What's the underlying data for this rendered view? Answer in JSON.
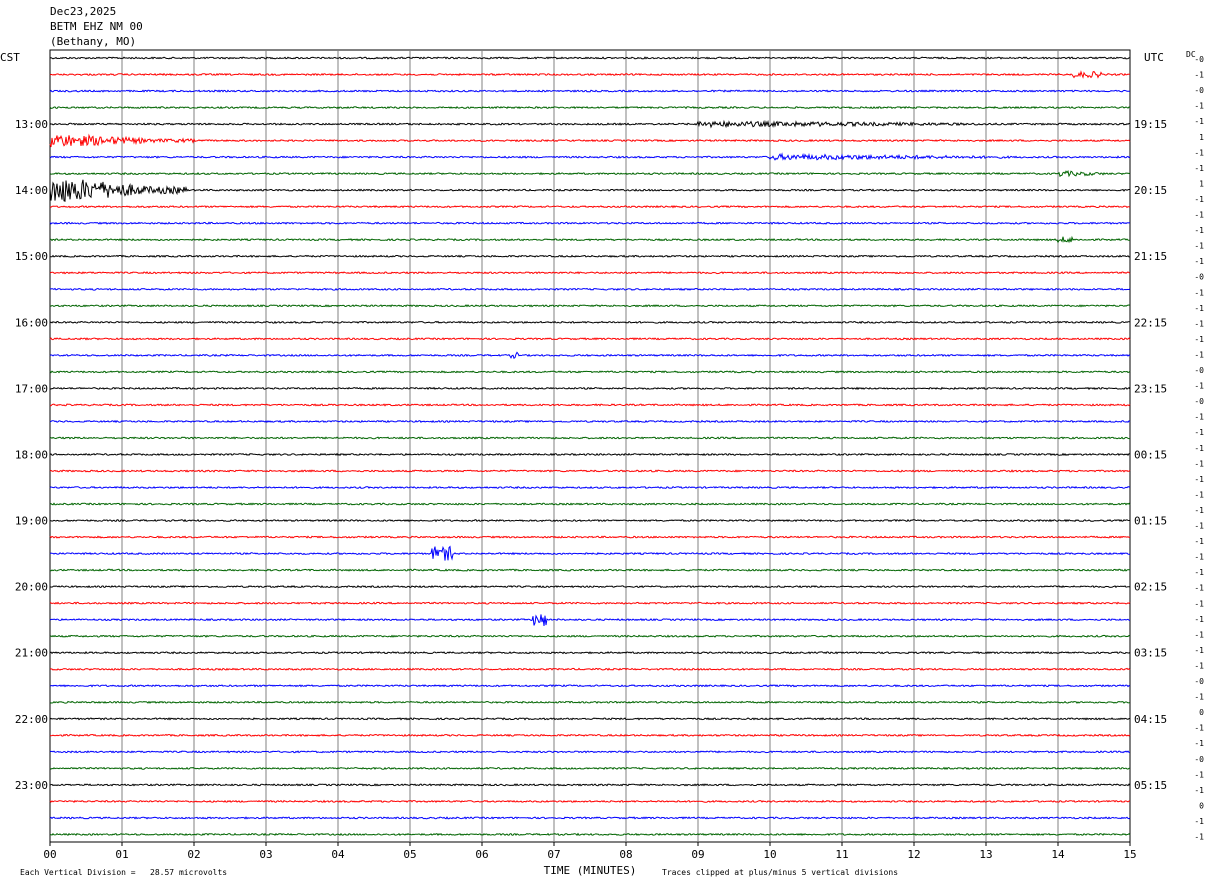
{
  "header": {
    "date": "Dec23,2025",
    "station": "BETM EHZ NM 00",
    "location": "(Bethany, MO)"
  },
  "footer": {
    "division_note": "Each Vertical Division =   28.57 microvolts",
    "clip_note": "Traces clipped at plus/minus 5 vertical divisions"
  },
  "chart_data": {
    "type": "seismogram",
    "left_axis_label": "CST",
    "right_axis_label": "UTC",
    "dc_label": "DC",
    "xlabel": "TIME (MINUTES)",
    "x_ticks": [
      "00",
      "01",
      "02",
      "03",
      "04",
      "05",
      "06",
      "07",
      "08",
      "09",
      "10",
      "11",
      "12",
      "13",
      "14",
      "15"
    ],
    "x_range_minutes": [
      0,
      15
    ],
    "trace_colors": [
      "#000000",
      "#ff0000",
      "#0000ff",
      "#006400"
    ],
    "trace_count": 48,
    "cst_labels": [
      "13:00",
      "14:00",
      "15:00",
      "16:00",
      "17:00",
      "18:00",
      "19:00",
      "20:00",
      "21:00",
      "22:00",
      "23:00"
    ],
    "utc_labels": [
      "19:15",
      "20:15",
      "21:15",
      "22:15",
      "23:15",
      "00:15",
      "01:15",
      "02:15",
      "03:15",
      "04:15",
      "05:15"
    ],
    "dc_offsets": [
      "-0",
      "-1",
      "-0",
      "-1",
      "-1",
      "1",
      "-1",
      "-1",
      "1",
      "-1",
      "-1",
      "-1",
      "-1",
      "-1",
      "-0",
      "-1",
      "-1",
      "-1",
      "-1",
      "-1",
      "-0",
      "-1",
      "-0",
      "-1",
      "-1",
      "-1",
      "-1",
      "-1",
      "-1",
      "-1",
      "-1",
      "-1",
      "-1",
      "-1",
      "-1",
      "-1",
      "-1",
      "-1",
      "-1",
      "-1",
      "-0",
      "-1",
      "0",
      "-1",
      "-1",
      "-0",
      "-1",
      "-1",
      "0",
      "-1",
      "-1"
    ],
    "events": [
      {
        "trace": 8,
        "start_min": 0.0,
        "end_min": 1.9,
        "amplitude": "large"
      },
      {
        "trace": 5,
        "start_min": 0.0,
        "end_min": 2.0,
        "amplitude": "medium"
      },
      {
        "trace": 4,
        "start_min": 9.0,
        "end_min": 15.0,
        "amplitude": "small"
      },
      {
        "trace": 6,
        "start_min": 10.0,
        "end_min": 15.0,
        "amplitude": "small"
      },
      {
        "trace": 7,
        "start_min": 14.0,
        "end_min": 15.0,
        "amplitude": "small"
      },
      {
        "trace": 1,
        "start_min": 14.2,
        "end_min": 14.6,
        "amplitude": "small"
      },
      {
        "trace": 30,
        "start_min": 5.3,
        "end_min": 5.6,
        "amplitude": "medium"
      },
      {
        "trace": 34,
        "start_min": 6.7,
        "end_min": 6.9,
        "amplitude": "medium"
      },
      {
        "trace": 18,
        "start_min": 6.4,
        "end_min": 6.5,
        "amplitude": "small"
      },
      {
        "trace": 11,
        "start_min": 14.0,
        "end_min": 14.2,
        "amplitude": "small"
      }
    ]
  }
}
